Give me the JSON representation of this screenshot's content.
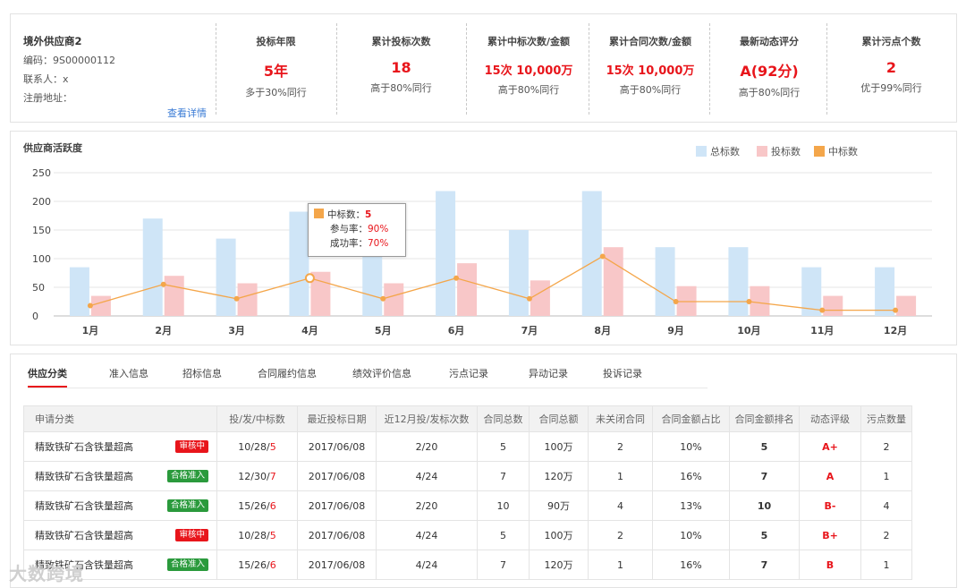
{
  "supplier": {
    "name": "境外供应商2",
    "code": "编码：9S00000112",
    "contact": "联系人：x",
    "address": "注册地址：",
    "detail_link": "查看详情"
  },
  "stats": [
    {
      "title": "投标年限",
      "value": "5年",
      "sub": "多于30%同行"
    },
    {
      "title": "累计投标次数",
      "value": "18",
      "sub": "高于80%同行"
    },
    {
      "title": "累计中标次数/金额",
      "value": "15次  10,000万",
      "sub": "高于80%同行"
    },
    {
      "title": "累计合同次数/金额",
      "value": "15次  10,000万",
      "sub": "高于80%同行"
    },
    {
      "title": "最新动态评分",
      "value": "A(92分)",
      "sub": "高于80%同行"
    },
    {
      "title": "累计污点个数",
      "value": "2",
      "sub": "优于99%同行"
    }
  ],
  "chart_data": {
    "type": "bar",
    "title": "供应商活跃度",
    "categories": [
      "1月",
      "2月",
      "3月",
      "4月",
      "5月",
      "6月",
      "7月",
      "8月",
      "9月",
      "10月",
      "11月",
      "12月"
    ],
    "series": [
      {
        "name": "总标数",
        "type": "bar",
        "color": "#cfe5f7",
        "values": [
          85,
          170,
          135,
          182,
          108,
          218,
          150,
          218,
          120,
          120,
          85,
          85
        ]
      },
      {
        "name": "投标数",
        "type": "bar",
        "color": "#f8c7c8",
        "values": [
          35,
          70,
          57,
          77,
          57,
          92,
          62,
          120,
          52,
          52,
          35,
          35
        ]
      },
      {
        "name": "中标数",
        "type": "line",
        "color": "#f4a64a",
        "values": [
          18,
          55,
          30,
          66,
          30,
          66,
          30,
          104,
          25,
          25,
          10,
          10
        ]
      }
    ],
    "ylim": [
      0,
      250
    ],
    "yticks": [
      0,
      50,
      100,
      150,
      200,
      250
    ],
    "grid": true,
    "legend": "top-right",
    "tooltip": {
      "label": "中标数：",
      "value": "5",
      "rate1_label": "参与率：",
      "rate1_value": "90%",
      "rate2_label": "成功率：",
      "rate2_value": "70%"
    }
  },
  "tabs": [
    "供应分类",
    "准入信息",
    "招标信息",
    "合同履约信息",
    "绩效评价信息",
    "污点记录",
    "异动记录",
    "投诉记录"
  ],
  "table": {
    "headers": [
      "申请分类",
      "投/发/中标数",
      "最近投标日期",
      "近12月投/发标次数",
      "合同总数",
      "合同总额",
      "未关闭合同",
      "合同金额占比",
      "合同金额排名",
      "动态评级",
      "污点数量"
    ],
    "rows": [
      {
        "category": "精致铁矿石含铁量超高",
        "status": "审核中",
        "status_color": "red",
        "bids_a": "10/28/",
        "bids_b": "5",
        "date": "2017/06/08",
        "recent": "2/20",
        "contracts": "5",
        "amount": "100万",
        "open": "2",
        "ratio": "10%",
        "rank": "5",
        "grade": "A+",
        "stains": "2"
      },
      {
        "category": "精致铁矿石含铁量超高",
        "status": "合格准入",
        "status_color": "green",
        "bids_a": "12/30/",
        "bids_b": "7",
        "date": "2017/06/08",
        "recent": "4/24",
        "contracts": "7",
        "amount": "120万",
        "open": "1",
        "ratio": "16%",
        "rank": "7",
        "grade": "A",
        "stains": "1"
      },
      {
        "category": "精致铁矿石含铁量超高",
        "status": "合格准入",
        "status_color": "green",
        "bids_a": "15/26/",
        "bids_b": "6",
        "date": "2017/06/08",
        "recent": "2/20",
        "contracts": "10",
        "amount": "90万",
        "open": "4",
        "ratio": "13%",
        "rank": "10",
        "grade": "B-",
        "stains": "4"
      },
      {
        "category": "精致铁矿石含铁量超高",
        "status": "审核中",
        "status_color": "red",
        "bids_a": "10/28/",
        "bids_b": "5",
        "date": "2017/06/08",
        "recent": "4/24",
        "contracts": "5",
        "amount": "100万",
        "open": "2",
        "ratio": "10%",
        "rank": "5",
        "grade": "B+",
        "stains": "2"
      },
      {
        "category": "精致铁矿石含铁量超高",
        "status": "合格准入",
        "status_color": "green",
        "bids_a": "15/26/",
        "bids_b": "6",
        "date": "2017/06/08",
        "recent": "4/24",
        "contracts": "7",
        "amount": "120万",
        "open": "1",
        "ratio": "16%",
        "rank": "7",
        "grade": "B",
        "stains": "1"
      }
    ]
  },
  "watermark": "大数跨境"
}
